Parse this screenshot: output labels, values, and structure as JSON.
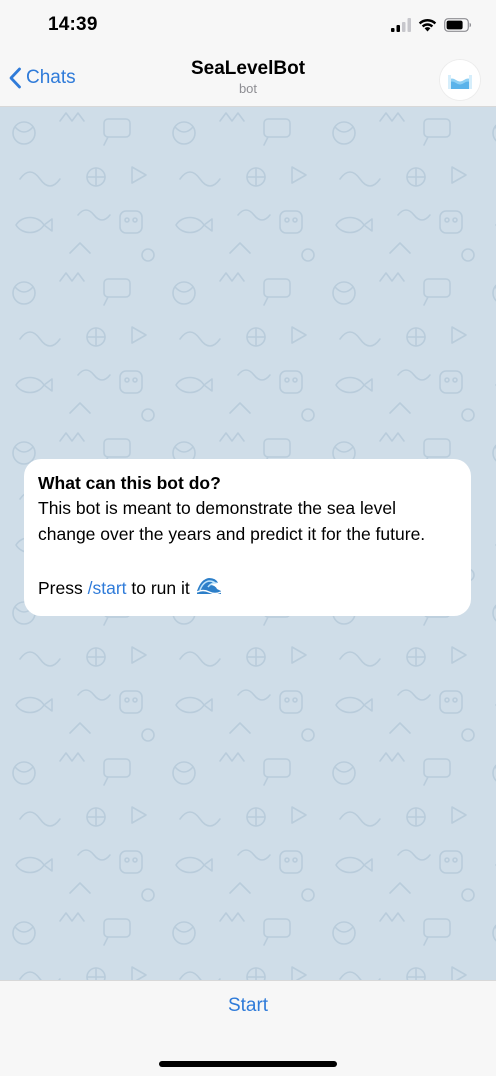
{
  "status_bar": {
    "time": "14:39",
    "icons": [
      "cellular-signal-icon",
      "wifi-icon",
      "battery-icon"
    ]
  },
  "nav": {
    "back_label": "Chats",
    "title": "SeaLevelBot",
    "subtitle": "bot",
    "avatar_icon": "sea-wave-avatar"
  },
  "bot_info": {
    "title": "What can this bot do?",
    "description": "This bot is meant to demonstrate the sea level change over the years and predict it for the future.",
    "press_prefix": "Press ",
    "command": "/start",
    "press_suffix": " to run it",
    "emoji_icon": "water-wave-emoji"
  },
  "bottom": {
    "start_label": "Start"
  },
  "colors": {
    "accent": "#2f7bd9",
    "chat_background": "#cfdde8",
    "pattern": "#b9ccdb",
    "bar_background": "#f7f7f7",
    "card_background": "#ffffff"
  }
}
